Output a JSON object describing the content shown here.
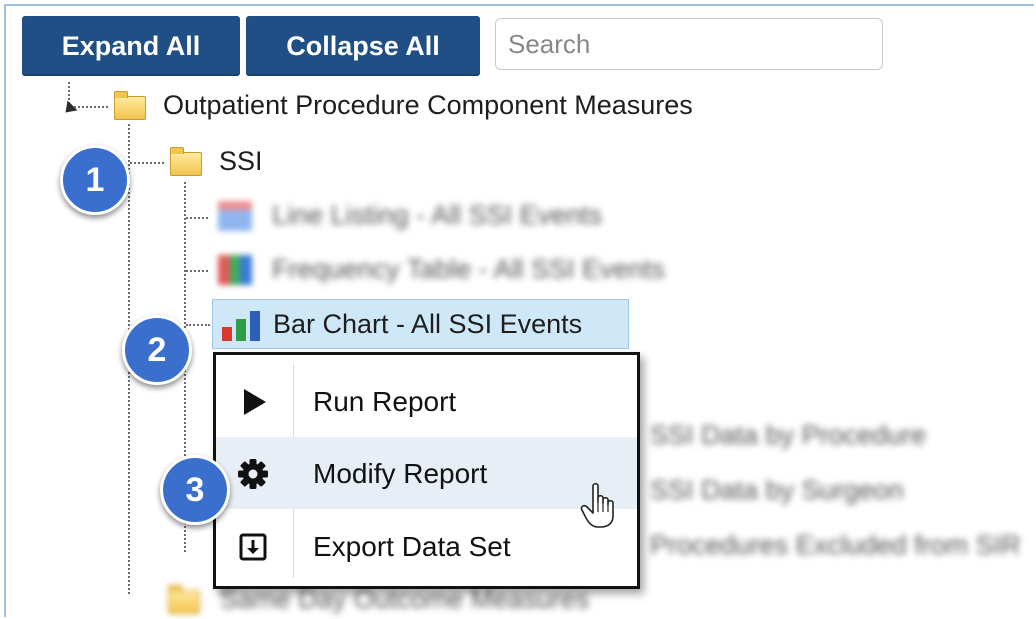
{
  "toolbar": {
    "expand_label": "Expand All",
    "collapse_label": "Collapse All"
  },
  "search": {
    "placeholder": "Search",
    "value": ""
  },
  "tree": {
    "root": {
      "label": "Outpatient Procedure Component Measures",
      "icon": "folder-icon"
    },
    "folder": {
      "label": "SSI",
      "icon": "folder-icon"
    },
    "items": [
      {
        "label": "Line Listing - All SSI Events",
        "blurred": true,
        "icon": "line-listing-icon"
      },
      {
        "label": "Frequency Table - All SSI Events",
        "blurred": true,
        "icon": "frequency-table-icon"
      },
      {
        "label": "Bar Chart - All SSI Events",
        "selected": true,
        "icon": "bar-chart-icon"
      },
      {
        "label": "SSI Data by Procedure",
        "blurred": true
      },
      {
        "label": "SSI Data by Surgeon",
        "blurred": true
      },
      {
        "label": "Procedures Excluded from SIR",
        "blurred": true
      },
      {
        "label": "Same Day Outcome Measures",
        "blurred": true,
        "icon": "folder-icon"
      }
    ]
  },
  "context_menu": {
    "items": [
      {
        "label": "Run Report",
        "icon": "play-icon"
      },
      {
        "label": "Modify Report",
        "icon": "gear-icon",
        "hovered": true
      },
      {
        "label": "Export Data Set",
        "icon": "export-icon"
      }
    ]
  },
  "callouts": [
    "1",
    "2",
    "3"
  ],
  "colors": {
    "button_bg": "#1f4f84",
    "selection_bg": "#cfe8f8",
    "callout_bg": "#3b6fce",
    "menu_hover_bg": "#e8eef6"
  }
}
